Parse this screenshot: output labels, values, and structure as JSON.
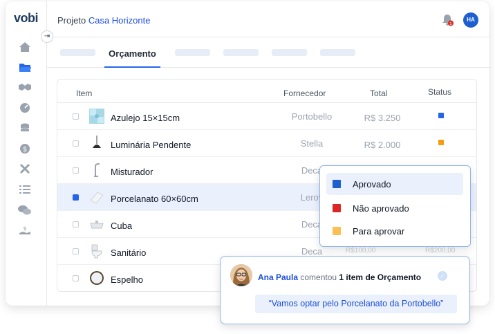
{
  "app": {
    "logo": "vobi"
  },
  "header": {
    "breadcrumb_prefix": "Projeto",
    "project_name": "Casa Horizonte",
    "notifications_count": "1",
    "user_initials": "HA"
  },
  "sidebar": {
    "items": [
      {
        "icon": "home-icon"
      },
      {
        "icon": "folder-icon"
      },
      {
        "icon": "handshake-icon"
      },
      {
        "icon": "dashboard-icon"
      },
      {
        "icon": "coins-icon"
      },
      {
        "icon": "dollar-icon"
      },
      {
        "icon": "tools-icon"
      },
      {
        "icon": "list-icon"
      },
      {
        "icon": "chat-icon"
      },
      {
        "icon": "payment-icon"
      }
    ]
  },
  "tabs": {
    "active_label": "Orçamento"
  },
  "table": {
    "columns": {
      "item": "Item",
      "supplier": "Fornecedor",
      "total": "Total",
      "status": "Status"
    },
    "rows": [
      {
        "name": "Azulejo 15×15cm",
        "supplier": "Portobello",
        "total": "R$ 3.250",
        "status_color": "#2563eb",
        "thumb": "tile-icon"
      },
      {
        "name": "Luminária Pendente",
        "supplier": "Stella",
        "total": "R$ 2.000",
        "status_color": "#f59e0b",
        "thumb": "lamp-icon"
      },
      {
        "name": "Misturador",
        "supplier": "Deca",
        "total": "",
        "status_color": "",
        "thumb": "faucet-icon"
      },
      {
        "name": "Porcelanato 60×60cm",
        "supplier": "Leroy",
        "total": "",
        "status_color": "",
        "thumb": "porcelain-icon"
      },
      {
        "name": "Cuba",
        "supplier": "Deca",
        "total": "",
        "status_color": "",
        "thumb": "sink-icon"
      },
      {
        "name": "Sanitário",
        "supplier": "Deca",
        "total": "R$100,00",
        "total_extra": "R$200,00",
        "status_color": "",
        "thumb": "toilet-icon"
      },
      {
        "name": "Espelho",
        "supplier": "",
        "total": "",
        "status_color": "",
        "thumb": "mirror-icon"
      }
    ]
  },
  "status_popover": {
    "options": [
      {
        "label": "Aprovado",
        "color": "#1d5fd1"
      },
      {
        "label": "Não aprovado",
        "color": "#dc2626"
      },
      {
        "label": "Para aprovar",
        "color": "#fbbf53"
      }
    ]
  },
  "comment": {
    "author": "Ana Paula",
    "verb": "comentou",
    "summary": "1 item de Orçamento",
    "quote": "“Vamos optar pelo Porcelanato da Portobello”"
  }
}
